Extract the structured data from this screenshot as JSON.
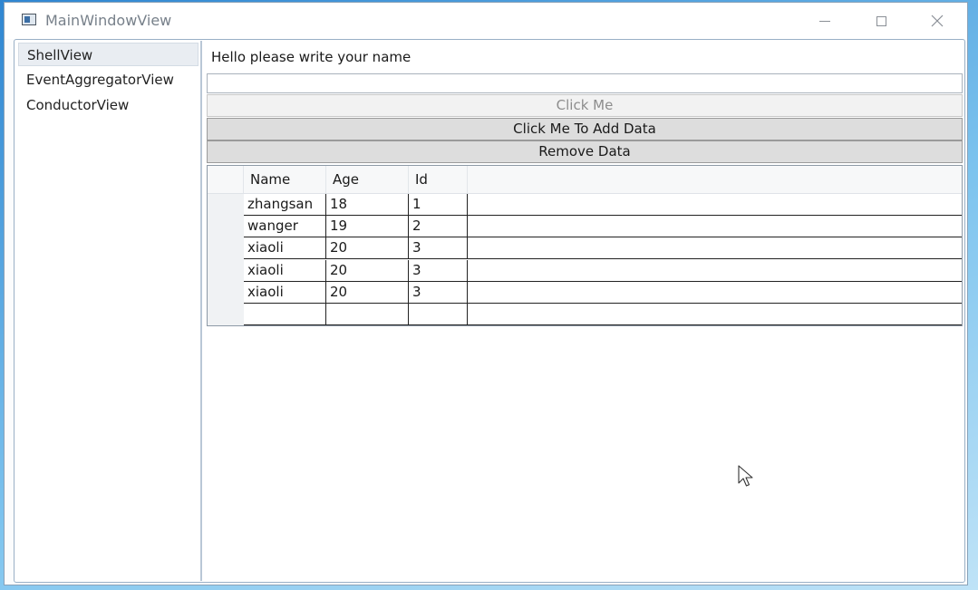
{
  "window": {
    "title": "MainWindowView",
    "controls": {
      "minimize": "minimize-icon",
      "maximize": "maximize-icon",
      "close": "close-icon"
    }
  },
  "sidebar": {
    "items": [
      {
        "label": "ShellView",
        "selected": true
      },
      {
        "label": "EventAggregatorView",
        "selected": false
      },
      {
        "label": "ConductorView",
        "selected": false
      }
    ]
  },
  "main": {
    "prompt": "Hello please write your name",
    "name_input": {
      "value": "",
      "placeholder": ""
    },
    "buttons": {
      "click_me": "Click Me",
      "add_data": "Click Me To Add Data",
      "remove_data": "Remove Data"
    },
    "grid": {
      "columns": [
        "Name",
        "Age",
        "Id"
      ],
      "rows": [
        [
          "zhangsan",
          "18",
          "1"
        ],
        [
          "wanger",
          "19",
          "2"
        ],
        [
          "xiaoli",
          "20",
          "3"
        ],
        [
          "xiaoli",
          "20",
          "3"
        ],
        [
          "xiaoli",
          "20",
          "3"
        ],
        [
          "",
          "",
          ""
        ]
      ]
    }
  },
  "colors": {
    "accent": "#3b6ea5",
    "button_bg": "#dddddd",
    "disabled_button_bg": "#f2f2f2",
    "desktop_bg": "#4a9ad6"
  }
}
